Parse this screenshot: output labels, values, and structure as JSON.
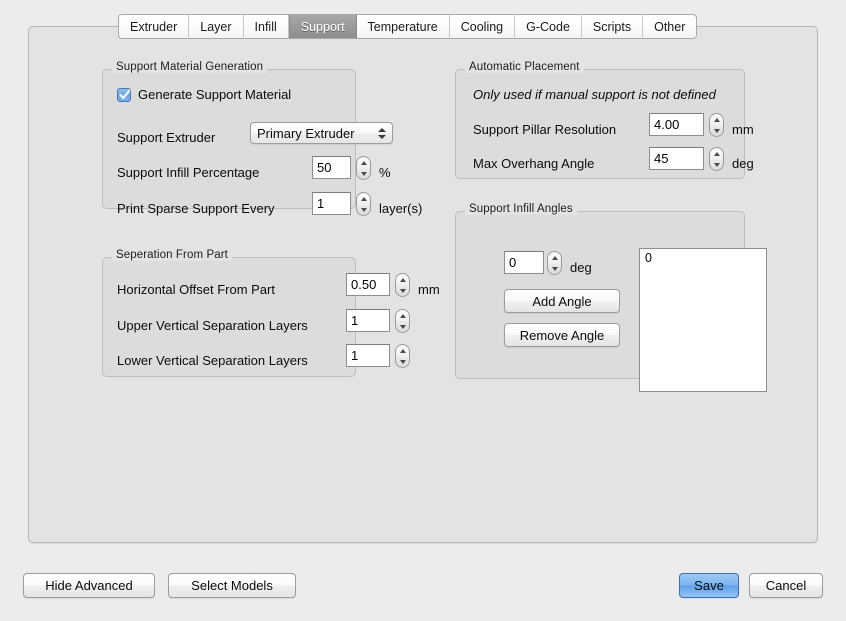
{
  "window": {
    "background": "#ececec",
    "panel_background": "#e3e3e3",
    "group_background": "#dcdcdc",
    "accent": "#6aa6e2"
  },
  "tabs": [
    {
      "label": "Extruder",
      "selected": false
    },
    {
      "label": "Layer",
      "selected": false
    },
    {
      "label": "Infill",
      "selected": false
    },
    {
      "label": "Support",
      "selected": true
    },
    {
      "label": "Temperature",
      "selected": false
    },
    {
      "label": "Cooling",
      "selected": false
    },
    {
      "label": "G-Code",
      "selected": false
    },
    {
      "label": "Scripts",
      "selected": false
    },
    {
      "label": "Other",
      "selected": false
    }
  ],
  "support_material_generation": {
    "legend": "Support Material Generation",
    "generate_checkbox": {
      "label": "Generate Support Material",
      "checked": true
    },
    "support_extruder": {
      "label": "Support Extruder",
      "value": "Primary Extruder",
      "options": [
        "Primary Extruder"
      ]
    },
    "support_infill_percentage": {
      "label": "Support Infill Percentage",
      "value": "50",
      "unit": "%"
    },
    "print_sparse_support_every": {
      "label": "Print Sparse Support Every",
      "value": "1",
      "unit": "layer(s)"
    }
  },
  "separation_from_part": {
    "legend": "Seperation From Part",
    "horizontal_offset": {
      "label": "Horizontal Offset From Part",
      "value": "0.50",
      "unit": "mm"
    },
    "upper_vertical": {
      "label": "Upper Vertical Separation Layers",
      "value": "1",
      "unit": ""
    },
    "lower_vertical": {
      "label": "Lower Vertical Separation Layers",
      "value": "1",
      "unit": ""
    }
  },
  "automatic_placement": {
    "legend": "Automatic Placement",
    "note": "Only used if manual support is not defined",
    "pillar_resolution": {
      "label": "Support Pillar Resolution",
      "value": "4.00",
      "unit": "mm"
    },
    "max_overhang_angle": {
      "label": "Max Overhang Angle",
      "value": "45",
      "unit": "deg"
    }
  },
  "support_infill_angles": {
    "legend": "Support Infill Angles",
    "angle_input": {
      "value": "0",
      "unit": "deg"
    },
    "add_button": "Add Angle",
    "remove_button": "Remove Angle",
    "angle_list": [
      "0"
    ]
  },
  "footer": {
    "hide_advanced": "Hide Advanced",
    "select_models": "Select Models",
    "save": "Save",
    "cancel": "Cancel"
  }
}
